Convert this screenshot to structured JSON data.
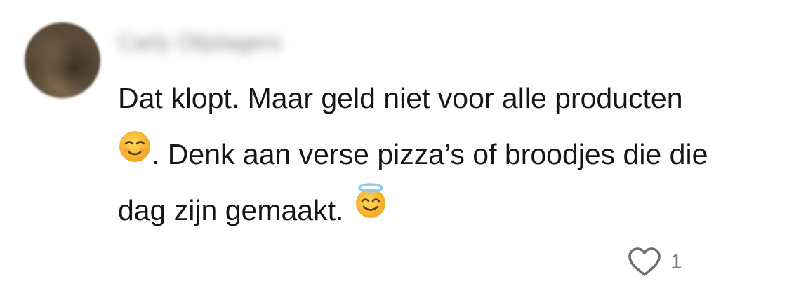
{
  "comment": {
    "author": "Carly Olijslagers",
    "line1": "Dat klopt. Maar geld niet voor alle producten",
    "line2_text": ". Denk aan verse pizza’s of broodjes die die",
    "line3_text": "dag zijn gemaakt. ",
    "emoji_1": "smiling-face-icon",
    "emoji_2": "halo-face-icon",
    "like_count": "1"
  },
  "colors": {
    "text": "#161616",
    "muted": "#7a7a7a",
    "emoji_yellow": "#f7b52a",
    "halo_blue": "#8ecbf0"
  }
}
